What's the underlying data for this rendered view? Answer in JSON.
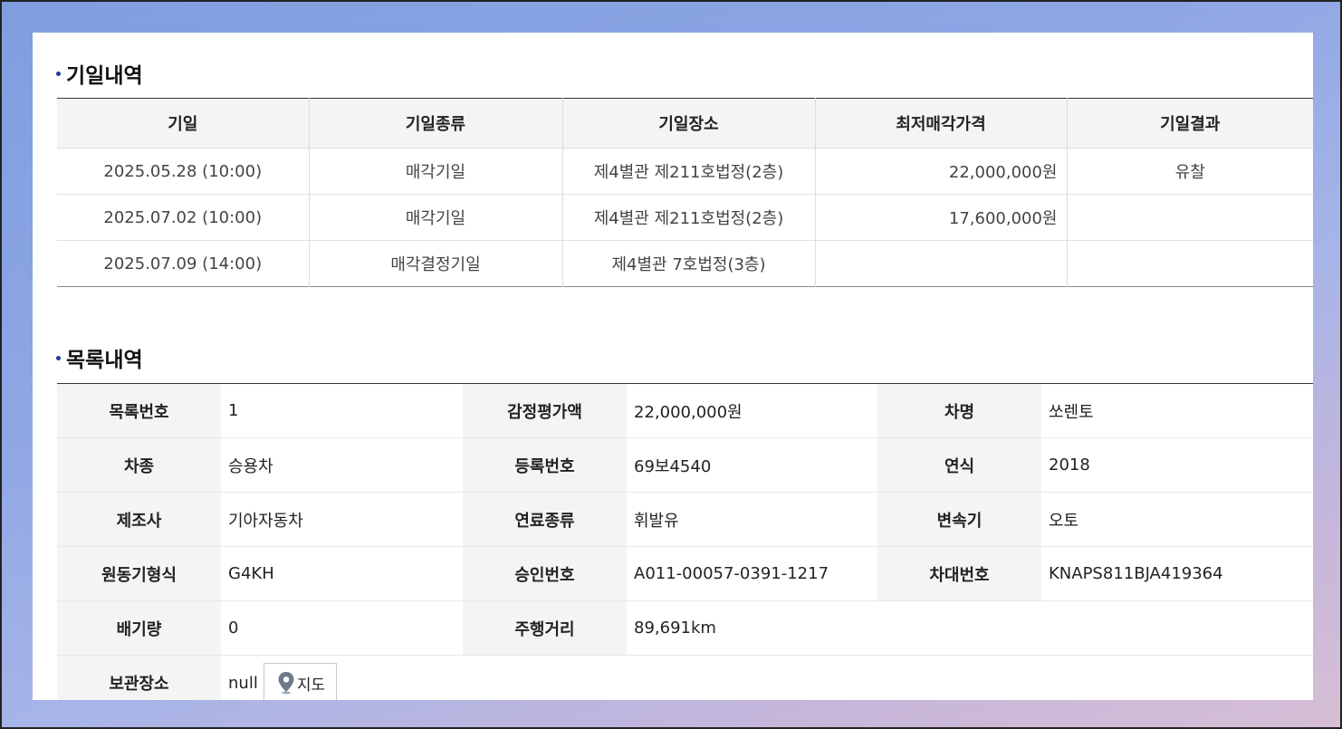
{
  "schedule": {
    "title": "기일내역",
    "headers": [
      "기일",
      "기일종류",
      "기일장소",
      "최저매각가격",
      "기일결과"
    ],
    "rows": [
      [
        "2025.05.28 (10:00)",
        "매각기일",
        "제4별관 제211호법정(2층)",
        "22,000,000원",
        "유찰"
      ],
      [
        "2025.07.02 (10:00)",
        "매각기일",
        "제4별관 제211호법정(2층)",
        "17,600,000원",
        ""
      ],
      [
        "2025.07.09 (14:00)",
        "매각결정기일",
        "제4별관 7호법정(3층)",
        "",
        ""
      ]
    ]
  },
  "items": {
    "title": "목록내역",
    "rows": [
      [
        {
          "label": "목록번호",
          "value": "1"
        },
        {
          "label": "감정평가액",
          "value": "22,000,000원"
        },
        {
          "label": "차명",
          "value": "쏘렌토"
        }
      ],
      [
        {
          "label": "차종",
          "value": "승용차"
        },
        {
          "label": "등록번호",
          "value": "69보4540"
        },
        {
          "label": "연식",
          "value": "2018"
        }
      ],
      [
        {
          "label": "제조사",
          "value": "기아자동차"
        },
        {
          "label": "연료종류",
          "value": "휘발유"
        },
        {
          "label": "변속기",
          "value": "오토"
        }
      ],
      [
        {
          "label": "원동기형식",
          "value": "G4KH"
        },
        {
          "label": "승인번호",
          "value": "A011-00057-0391-1217"
        },
        {
          "label": "차대번호",
          "value": "KNAPS811BJA419364"
        }
      ],
      [
        {
          "label": "배기량",
          "value": "0"
        },
        {
          "label": "주행거리",
          "value": "89,691km"
        }
      ]
    ],
    "storage": {
      "label": "보관장소",
      "value": "null",
      "map_button": "지도",
      "map_icon": "map-pin-icon"
    }
  },
  "colors": {
    "accent_bullet": "#1f3a93",
    "map_pin": "#6b7b8c"
  }
}
